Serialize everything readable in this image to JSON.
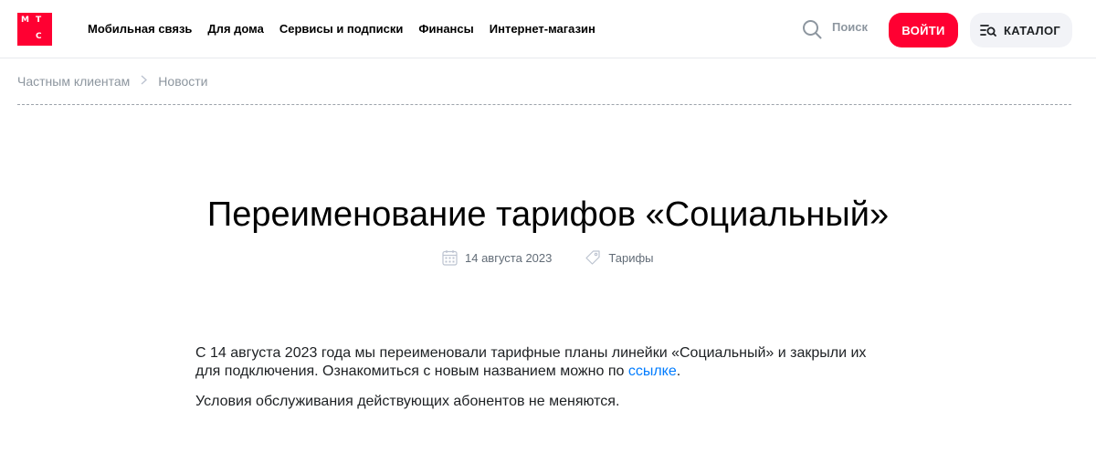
{
  "header": {
    "logo_letters": [
      "М",
      "Т",
      "С"
    ],
    "nav": [
      "Мобильная связь",
      "Для дома",
      "Сервисы и подписки",
      "Финансы",
      "Интернет-магазин"
    ],
    "search_label": "Поиск",
    "login_label": "ВОЙТИ",
    "catalog_label": "КАТАЛОГ"
  },
  "breadcrumb": [
    "Частным клиентам",
    "Новости"
  ],
  "article": {
    "title": "Переименование тарифов «Социальный»",
    "date": "14 августа 2023",
    "tag": "Тарифы",
    "paragraph1_text": "С 14 августа 2023 года мы переименовали тарифные планы линейки «Социальный» и закрыли их для подключения. Ознакомиться с новым названием можно по ",
    "paragraph1_link": "ссылке",
    "paragraph1_end": ".",
    "paragraph2": "Условия обслуживания действующих абонентов не меняются."
  },
  "colors": {
    "brand": "#ff0032",
    "link": "#007cff",
    "muted": "#8d969f"
  },
  "icons": [
    "search-icon",
    "catalog-icon",
    "calendar-icon",
    "tag-icon",
    "chevron-right-icon"
  ]
}
